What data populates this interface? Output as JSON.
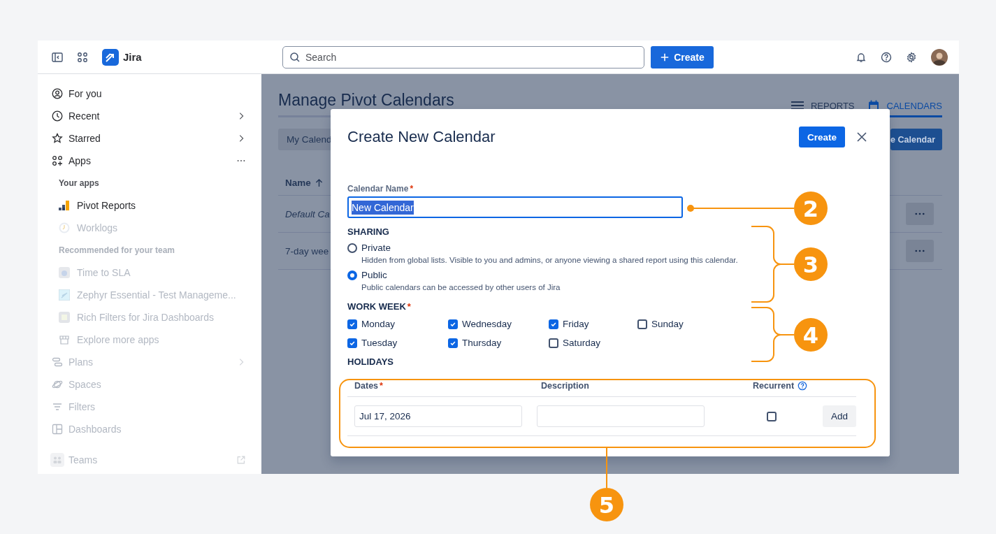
{
  "topbar": {
    "product": "Jira",
    "search": {
      "placeholder": "Search"
    },
    "create_button": "Create"
  },
  "sidebar": {
    "items": [
      {
        "kind": "nav",
        "label": "For you",
        "dimmed": false
      },
      {
        "kind": "nav",
        "label": "Recent",
        "expandable": true,
        "dimmed": false
      },
      {
        "kind": "nav",
        "label": "Starred",
        "expandable": true,
        "dimmed": false
      },
      {
        "kind": "nav",
        "label": "Apps",
        "has_menu": true,
        "dimmed": false
      },
      {
        "kind": "heading",
        "label": "Your apps",
        "dimmed": false
      },
      {
        "kind": "app",
        "label": "Pivot Reports",
        "dimmed": false
      },
      {
        "kind": "app",
        "label": "Worklogs",
        "dimmed": true
      },
      {
        "kind": "heading",
        "label": "Recommended for your team",
        "dimmed": true
      },
      {
        "kind": "app",
        "label": "Time to SLA",
        "dimmed": true
      },
      {
        "kind": "app",
        "label": "Zephyr Essential - Test Manageme...",
        "dimmed": true
      },
      {
        "kind": "app",
        "label": "Rich Filters for Jira Dashboards",
        "dimmed": true
      },
      {
        "kind": "app",
        "label": "Explore more apps",
        "dimmed": true
      },
      {
        "kind": "nav",
        "label": "Plans",
        "expandable": true,
        "dimmed": true
      },
      {
        "kind": "nav",
        "label": "Spaces",
        "dimmed": true
      },
      {
        "kind": "nav",
        "label": "Filters",
        "dimmed": true
      },
      {
        "kind": "nav",
        "label": "Dashboards",
        "dimmed": true
      },
      {
        "kind": "footer",
        "label": "Teams",
        "external": true,
        "dimmed": true
      }
    ]
  },
  "main": {
    "title": "Manage Pivot Calendars",
    "tabs": [
      {
        "label": "REPORTS",
        "selected": false
      },
      {
        "label": "CALENDARS",
        "selected": true
      }
    ],
    "filter_button": "My Calend",
    "new_button": "e Calendar",
    "table": {
      "columns": [
        {
          "label": "Name",
          "sorted_ascending": true
        }
      ],
      "rows": [
        {
          "name": "Default Ca",
          "italic": true
        },
        {
          "name": "7-day wee",
          "italic": false
        }
      ]
    }
  },
  "dialog": {
    "title": "Create New Calendar",
    "create_button": "Create",
    "name_field": {
      "label": "Calendar Name",
      "required_mark": "*",
      "value": "New Calendar",
      "text_selected": true
    },
    "sharing": {
      "heading": "SHARING",
      "options": [
        {
          "label": "Private",
          "description": "Hidden from global lists. Visible to you and admins, or anyone viewing a shared report using this calendar.",
          "selected": false
        },
        {
          "label": "Public",
          "description": "Public calendars can be accessed by other users of Jira",
          "selected": true
        }
      ]
    },
    "work_week": {
      "heading": "WORK WEEK",
      "required_mark": "*",
      "days": [
        {
          "label": "Monday",
          "checked": true
        },
        {
          "label": "Tuesday",
          "checked": true
        },
        {
          "label": "Wednesday",
          "checked": true
        },
        {
          "label": "Thursday",
          "checked": true
        },
        {
          "label": "Friday",
          "checked": true
        },
        {
          "label": "Saturday",
          "checked": false
        },
        {
          "label": "Sunday",
          "checked": false
        }
      ]
    },
    "holidays": {
      "heading": "HOLIDAYS",
      "columns": [
        {
          "label": "Dates",
          "required_mark": "*"
        },
        {
          "label": "Description"
        },
        {
          "label": "Recurrent",
          "help": true
        }
      ],
      "row": {
        "date": "Jul 17, 2026",
        "recurrent": false,
        "add_button": "Add"
      }
    }
  },
  "annotations": [
    {
      "number": "2",
      "kind": "pointer"
    },
    {
      "number": "3",
      "kind": "bracket"
    },
    {
      "number": "4",
      "kind": "bracket"
    },
    {
      "number": "5",
      "kind": "frame"
    }
  ]
}
